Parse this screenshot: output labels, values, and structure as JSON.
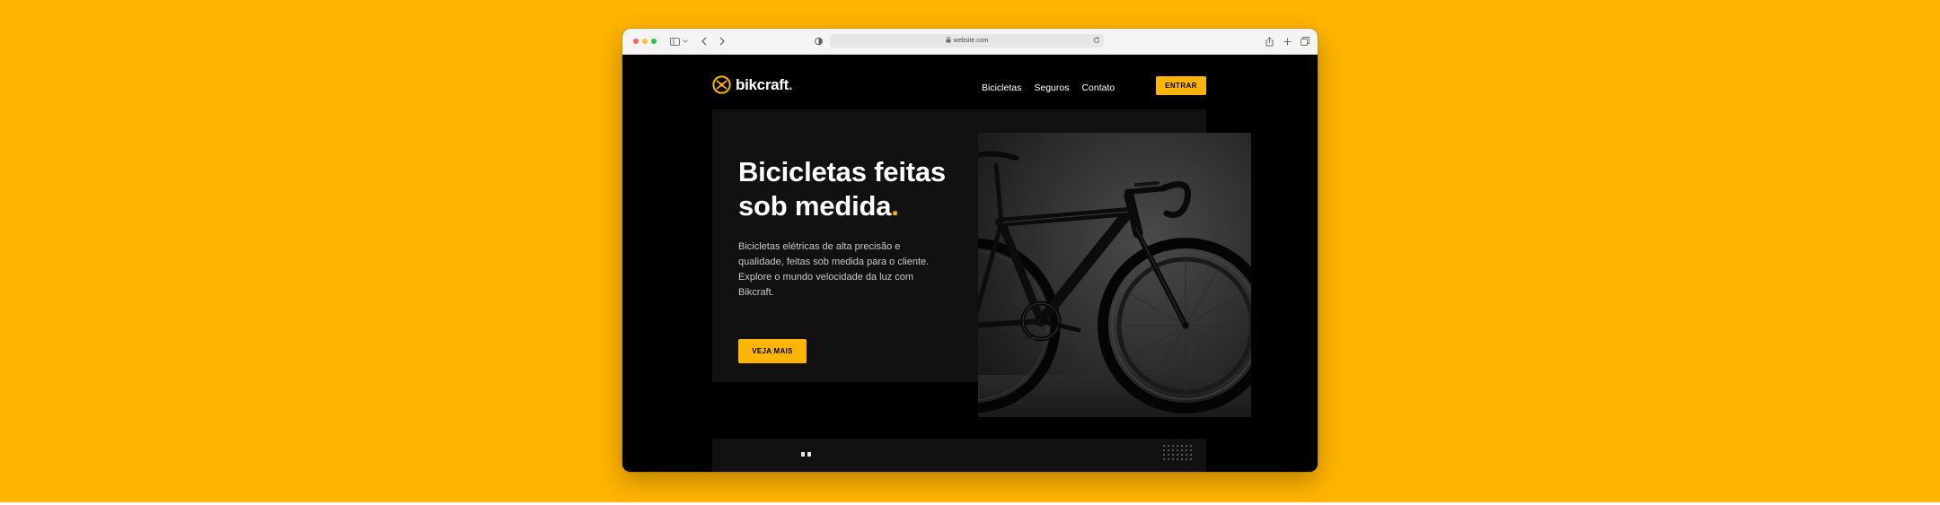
{
  "browser": {
    "url": "website.com",
    "colors": {
      "chrome": "#f5f4f2",
      "address_bar": "#e8e7e5"
    },
    "icons": [
      "sidebar-icon",
      "chevron-down-icon",
      "back-icon",
      "forward-icon",
      "privacy-shield-icon",
      "lock-icon",
      "reload-icon",
      "share-icon",
      "new-tab-icon",
      "tabs-overview-icon"
    ]
  },
  "site": {
    "brand": {
      "name": "bikcraft",
      "dot": "."
    },
    "nav": {
      "items": [
        "Bicicletas",
        "Seguros",
        "Contato"
      ]
    },
    "cta_enter": "ENTRAR",
    "hero": {
      "title_line1": "Bicicletas feitas",
      "title_line2": "sob medida",
      "title_dot": ".",
      "description": "Bicicletas elétricas de alta precisão e qualidade, feitas sob medida para o cliente. Explore o mundo velocidade da luz com Bikcraft.",
      "button": "VEJA MAIS",
      "image": "black road bicycle photo"
    },
    "colors": {
      "accent": "#FFB400",
      "background": "#000000",
      "panel": "#111111",
      "text": "#ffffff"
    }
  }
}
